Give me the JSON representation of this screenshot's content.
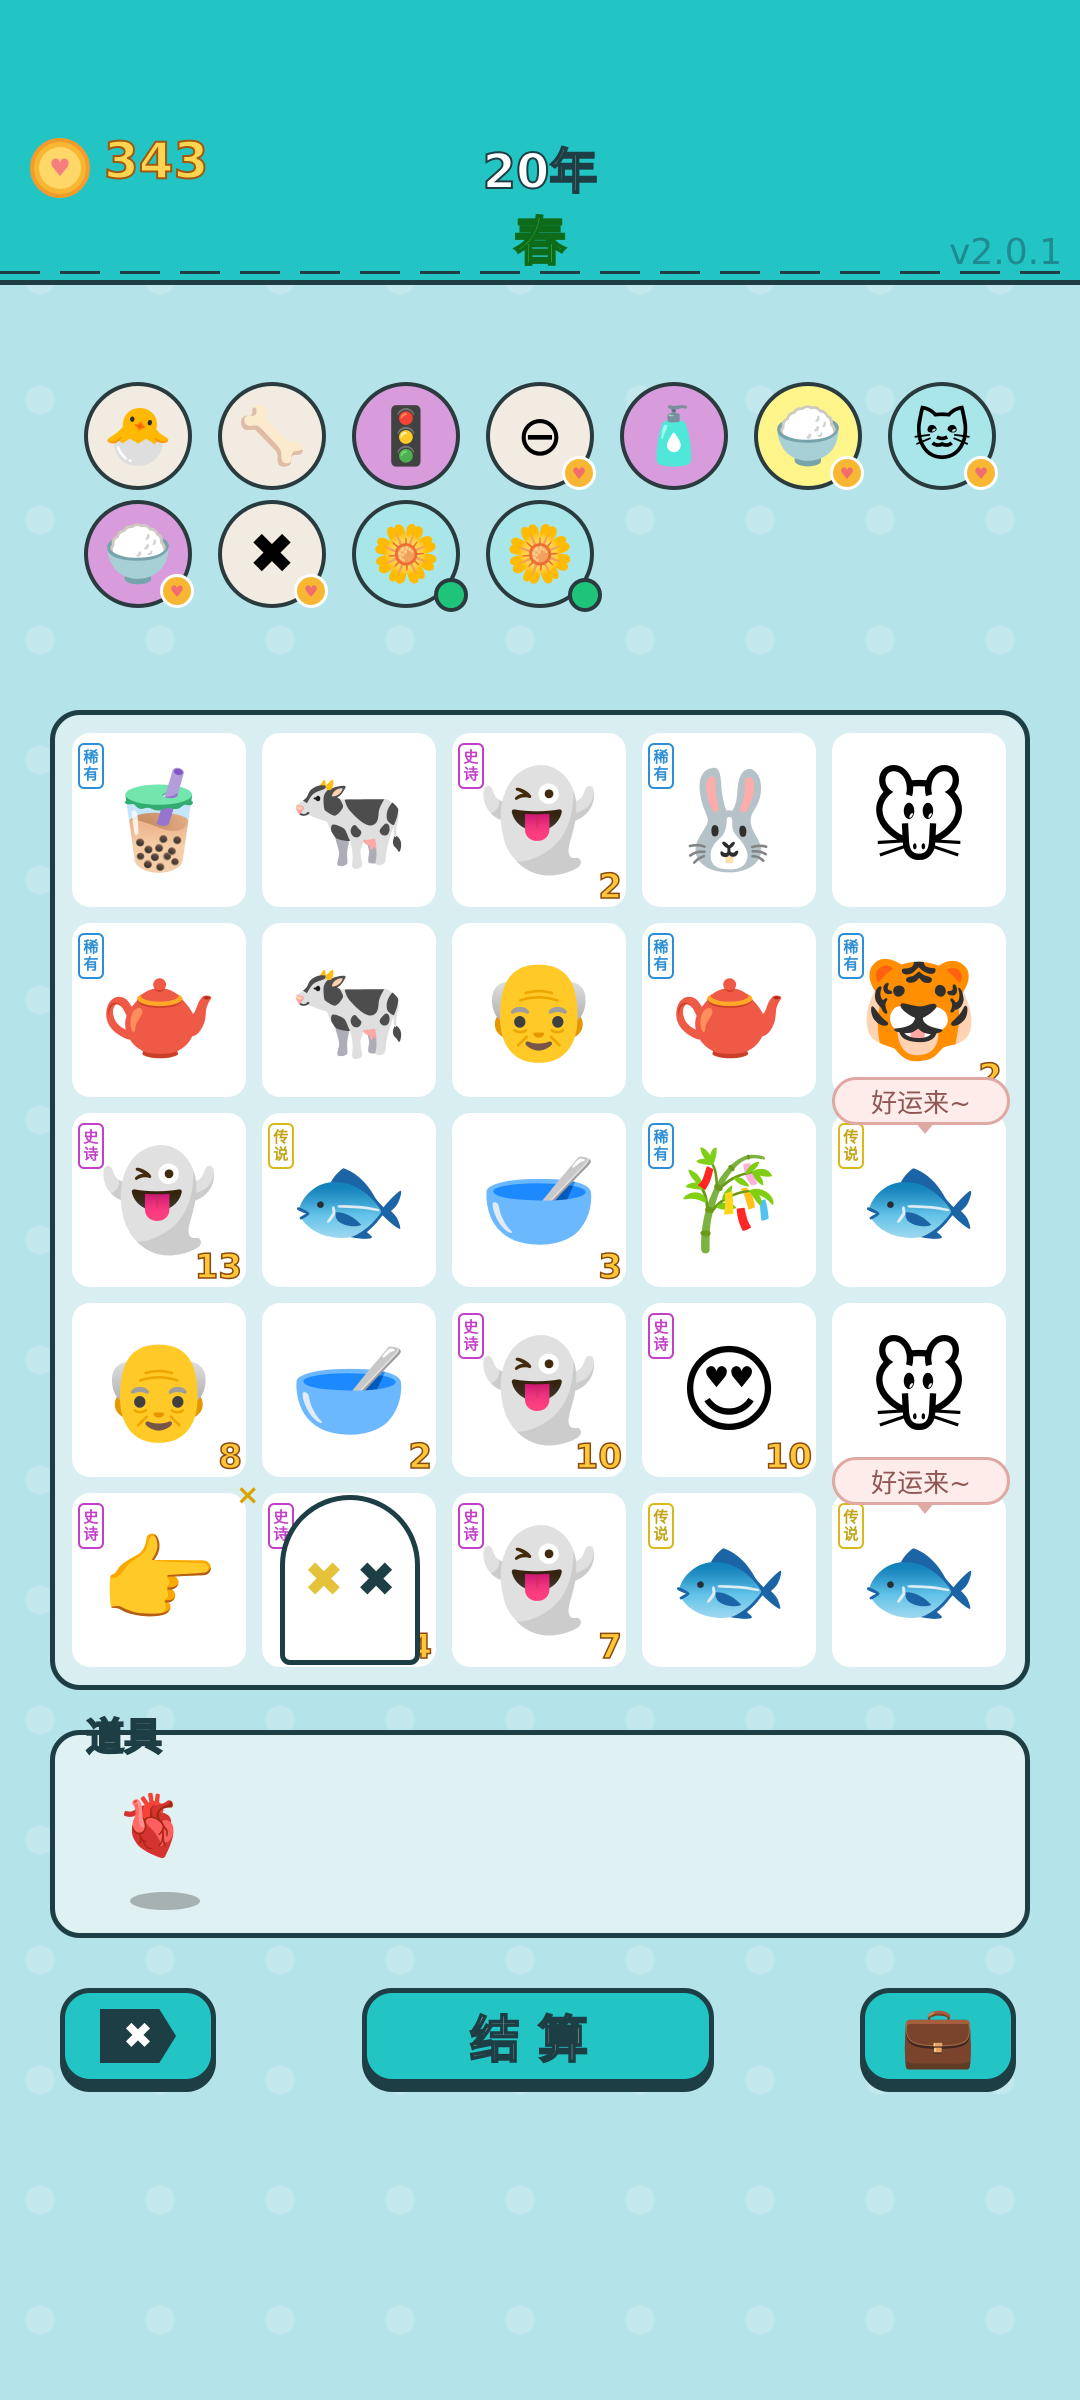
{
  "header": {
    "coins": "343",
    "year": "20年",
    "season": "春",
    "version": "v2.0.1"
  },
  "relics": [
    {
      "icon": "chicken-egg",
      "glyph": "🐣",
      "bg": "#f2ebe1",
      "badge": "none"
    },
    {
      "icon": "pet-food-bowl",
      "glyph": "🦴",
      "bg": "#f2ebe1",
      "badge": "none"
    },
    {
      "icon": "traffic-light-ghost",
      "glyph": "🚦",
      "bg": "#d89cdc",
      "badge": "none"
    },
    {
      "icon": "minus-circle",
      "glyph": "⊖",
      "bg": "#f2ebe1",
      "badge": "heart"
    },
    {
      "icon": "spray-bottle",
      "glyph": "🧴",
      "bg": "#d89cdc",
      "badge": "none"
    },
    {
      "icon": "rice-bowl",
      "glyph": "🍚",
      "bg": "#fdf48a",
      "badge": "heart"
    },
    {
      "icon": "cat",
      "glyph": "🐱",
      "bg": "#a9e6ea",
      "badge": "heart"
    },
    {
      "icon": "rice-bowl",
      "glyph": "🍚",
      "bg": "#d89cdc",
      "badge": "heart"
    },
    {
      "icon": "remove-tag",
      "glyph": "✖",
      "bg": "#f2ebe1",
      "badge": "heart"
    },
    {
      "icon": "flower-pot",
      "glyph": "🌼",
      "bg": "#a9e6ea",
      "badge": "green"
    },
    {
      "icon": "flower-pot",
      "glyph": "🌼",
      "bg": "#a9e6ea",
      "badge": "green"
    }
  ],
  "board": {
    "rows": [
      [
        {
          "name": "bubble-tea",
          "glyph": "🧋",
          "tag": "稀有",
          "tagClass": "rare",
          "count": ""
        },
        {
          "name": "cow",
          "glyph": "🐄",
          "tag": "",
          "tagClass": "",
          "count": ""
        },
        {
          "name": "ghost-dead",
          "glyph": "👻",
          "tag": "史诗",
          "tagClass": "epic",
          "count": "2"
        },
        {
          "name": "rabbit",
          "glyph": "🐰",
          "tag": "稀有",
          "tagClass": "rare",
          "count": ""
        },
        {
          "name": "mouse",
          "glyph": "🐭",
          "tag": "",
          "tagClass": "",
          "count": ""
        }
      ],
      [
        {
          "name": "teapot",
          "glyph": "🫖",
          "tag": "稀有",
          "tagClass": "rare",
          "count": ""
        },
        {
          "name": "cow",
          "glyph": "🐄",
          "tag": "",
          "tagClass": "",
          "count": ""
        },
        {
          "name": "old-man",
          "glyph": "👴",
          "tag": "",
          "tagClass": "",
          "count": ""
        },
        {
          "name": "teapot",
          "glyph": "🫖",
          "tag": "稀有",
          "tagClass": "rare",
          "count": ""
        },
        {
          "name": "tiger",
          "glyph": "🐯",
          "tag": "稀有",
          "tagClass": "rare",
          "count": "2"
        }
      ],
      [
        {
          "name": "ghost-dead",
          "glyph": "👻",
          "tag": "史诗",
          "tagClass": "epic",
          "count": "13"
        },
        {
          "name": "koi-fish",
          "glyph": "🐟",
          "tag": "传说",
          "tagClass": "legend",
          "count": ""
        },
        {
          "name": "soup-bowl",
          "glyph": "🥣",
          "tag": "",
          "tagClass": "",
          "count": "3"
        },
        {
          "name": "bamboo",
          "glyph": "🎋",
          "tag": "稀有",
          "tagClass": "rare",
          "count": ""
        },
        {
          "name": "koi-fish",
          "glyph": "🐟",
          "tag": "传说",
          "tagClass": "legend",
          "count": ""
        }
      ],
      [
        {
          "name": "old-man",
          "glyph": "👴",
          "tag": "",
          "tagClass": "",
          "count": "8"
        },
        {
          "name": "empty-bowl",
          "glyph": "🥣",
          "tag": "",
          "tagClass": "",
          "count": "2"
        },
        {
          "name": "ghost-love",
          "glyph": "👻",
          "tag": "史诗",
          "tagClass": "epic",
          "count": "10"
        },
        {
          "name": "girl-heart-eyes",
          "glyph": "😍",
          "tag": "史诗",
          "tagClass": "epic",
          "count": "10"
        },
        {
          "name": "mouse",
          "glyph": "🐭",
          "tag": "",
          "tagClass": "",
          "count": ""
        }
      ],
      [
        {
          "name": "pointing-hand",
          "glyph": "👉",
          "tag": "史诗",
          "tagClass": "epic",
          "count": ""
        },
        {
          "name": "ghost",
          "glyph": "👻",
          "tag": "史诗",
          "tagClass": "epic",
          "count": "4"
        },
        {
          "name": "ghost-love",
          "glyph": "👻",
          "tag": "史诗",
          "tagClass": "epic",
          "count": "7"
        },
        {
          "name": "koi-fish",
          "glyph": "🐟",
          "tag": "传说",
          "tagClass": "legend",
          "count": ""
        },
        {
          "name": "koi-fish",
          "glyph": "🐟",
          "tag": "传说",
          "tagClass": "legend",
          "count": ""
        }
      ]
    ],
    "bubble1": "好运来~",
    "bubble2": "好运来~",
    "marker": "×"
  },
  "items": {
    "title": "道具",
    "liver_icon": "🫀"
  },
  "buttons": {
    "remove_icon": "✖",
    "settle": "结算",
    "bag_icon": "💼"
  },
  "colors": {
    "header": "#22c4c4",
    "background": "#b5e3ea",
    "outline": "#1d3e44"
  }
}
